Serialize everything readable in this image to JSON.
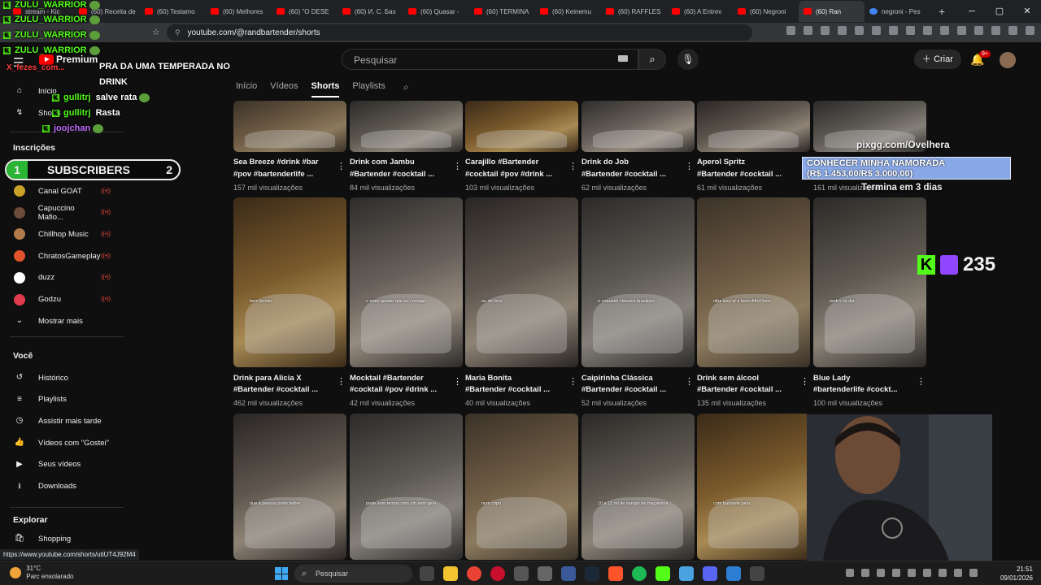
{
  "browser": {
    "tabs": [
      {
        "label": "stream - Kic"
      },
      {
        "label": "(60) Receita de"
      },
      {
        "label": "(60) Testamo"
      },
      {
        "label": "(60) Melhores"
      },
      {
        "label": "(60) \"O DESE"
      },
      {
        "label": "(60) И. С. Бах"
      },
      {
        "label": "(60) Quasar -"
      },
      {
        "label": "(60) TERMINA"
      },
      {
        "label": "(60) Keinemu"
      },
      {
        "label": "(60) RAFFLES"
      },
      {
        "label": "(60) A Entrev"
      },
      {
        "label": "(60) Negroni"
      },
      {
        "label": "(60) Ran"
      },
      {
        "label": "negroni - Pes"
      }
    ],
    "url": "youtube.com/@randbartender/shorts",
    "status_url": "https://www.youtube.com/shorts/utiUT4J92M4"
  },
  "youtube": {
    "premium_label": "Premium",
    "search_placeholder": "Pesquisar",
    "create_label": "Criar",
    "notif_badge": "9+",
    "channel_tabs": [
      "Início",
      "Vídeos",
      "Shorts",
      "Playlists"
    ],
    "active_tab": "Shorts"
  },
  "sidebar": {
    "top_items": [
      {
        "label": "Início",
        "icon": "home-icon"
      },
      {
        "label": "Shorts",
        "icon": "shorts-icon"
      }
    ],
    "subscriptions_title": "Inscrições",
    "subscriptions": [
      {
        "label": "Canal GOAT",
        "color": "#c9a227"
      },
      {
        "label": "Capuccino Mafio...",
        "color": "#6b4b3a"
      },
      {
        "label": "Chillhop Music",
        "color": "#b07a4a"
      },
      {
        "label": "ChratosGameplay",
        "color": "#e0532b"
      },
      {
        "label": "duzz",
        "color": "#ffffff"
      },
      {
        "label": "Godzu",
        "color": "#e03b4c"
      }
    ],
    "show_more": "Mostrar mais",
    "you_title": "Você",
    "you_items": [
      {
        "label": "Histórico",
        "icon": "history-icon"
      },
      {
        "label": "Playlists",
        "icon": "playlists-icon"
      },
      {
        "label": "Assistir mais tarde",
        "icon": "watch-later-icon"
      },
      {
        "label": "Vídeos com \"Gostei\"",
        "icon": "like-icon"
      },
      {
        "label": "Seus vídeos",
        "icon": "your-videos-icon"
      },
      {
        "label": "Downloads",
        "icon": "download-icon"
      }
    ],
    "explore_title": "Explorar",
    "explore_items": [
      {
        "label": "Shopping",
        "icon": "shopping-icon"
      }
    ]
  },
  "shorts": {
    "row1": [
      {
        "title1": "Sea Breeze #drink #bar",
        "title2": "#pov #bartenderlife ...",
        "views": "157 mil visualizações"
      },
      {
        "title1": "Drink com Jambu",
        "title2": "#Bartender #cocktail ...",
        "views": "84 mil visualizações"
      },
      {
        "title1": "Carajillo #Bartender",
        "title2": "#cocktail #pov #drink ...",
        "views": "103 mil visualizações"
      },
      {
        "title1": "Drink do Job",
        "title2": "#Bartender #cocktail ...",
        "views": "62 mil visualizações"
      },
      {
        "title1": "Aperol Spritz",
        "title2": "#Bartender #cocktail ...",
        "views": "61 mil visualizações"
      },
      {
        "title1": "",
        "title2": "",
        "views": "161 mil visualizações"
      }
    ],
    "row2": [
      {
        "title1": "Drink para Alicia X",
        "title2": "#Bartender #cocktail ...",
        "views": "462 mil visualizações",
        "caption": "bem bonito"
      },
      {
        "title1": "Mocktail #Bartender",
        "title2": "#cocktail #pov #drink ...",
        "views": "42 mil visualizações",
        "caption": "o mais gelado que eu consigo"
      },
      {
        "title1": "Maria Bonita",
        "title2": "#Bartender #cocktail ...",
        "views": "40 mil visualizações",
        "caption": "ou de licor"
      },
      {
        "title1": "Caipirinha Clássica",
        "title2": "#Bartender #cocktail ...",
        "views": "52 mil visualizações",
        "caption": "o coquetel clássico brasileiro"
      },
      {
        "title1": "Drink sem álcool",
        "title2": "#Bartender #cocktail ...",
        "views": "135 mil visualizações",
        "caption": "olha isso aí e bem difícil hein"
      },
      {
        "title1": "Blue Lady",
        "title2": "#bartenderlife #cockt...",
        "views": "100 mil visualizações",
        "caption": "pedro no dia"
      }
    ],
    "row3_captions": [
      "que a pessoa pode beber",
      "pode sem tempo com um sem gelo",
      "num copo",
      "10 a 15 ml de xarope de maçaneira",
      "com bastante gelo",
      ""
    ]
  },
  "overlay": {
    "chat": [
      {
        "user": "ZULU_WARRIOR",
        "msg": "",
        "color": "#53fc18"
      },
      {
        "user": "ZULU_WARRIOR",
        "msg": "",
        "color": "#53fc18"
      },
      {
        "user": "ZULU_WARRIOR",
        "msg": "",
        "color": "#53fc18"
      },
      {
        "user": "ZULU_WARRIOR",
        "msg": "",
        "color": "#53fc18"
      },
      {
        "user": "X_fezes_com...",
        "msg": "PRA DA UMA TEMPERADA NO",
        "color": "#ff4040"
      },
      {
        "user": "",
        "msg": "DRINK",
        "color": "#ffffff"
      },
      {
        "user": "gullitrj",
        "msg": "salve rata",
        "color": "#53fc18"
      },
      {
        "user": "gullitrj",
        "msg": "Rasta",
        "color": "#53fc18"
      },
      {
        "user": "joojchan",
        "msg": "",
        "color": "#c26bff"
      }
    ],
    "subs_left": "1",
    "subs_label": "SUBSCRIBERS",
    "subs_right": "2",
    "promo_url": "pixgg.com/Ovelhera",
    "promo_line1": "CONHECER MINHA NAMORADA",
    "promo_line2": "(R$ 1.453,00/R$ 3.000,00)",
    "promo_sub": "Termina em 3 dias",
    "viewers": "235"
  },
  "taskbar": {
    "temp": "31°C",
    "weather": "Parc ensolarado",
    "search": "Pesquisar",
    "time": "21:51",
    "date": "09/01/2026"
  }
}
